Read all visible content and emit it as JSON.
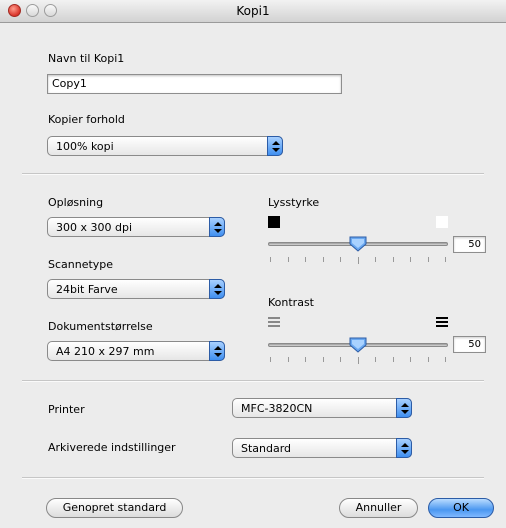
{
  "window": {
    "title": "Kopi1"
  },
  "name_section": {
    "label": "Navn til Kopi1",
    "value": "Copy1"
  },
  "ratio_section": {
    "label": "Kopier forhold",
    "selected": "100% kopi"
  },
  "resolution": {
    "label": "Opløsning",
    "selected": "300 x 300 dpi"
  },
  "scan_type": {
    "label": "Scannetype",
    "selected": "24bit Farve"
  },
  "doc_size": {
    "label": "Dokumentstørrelse",
    "selected": "A4 210 x 297 mm"
  },
  "brightness": {
    "label": "Lysstyrke",
    "value": "50",
    "level": 0.5
  },
  "contrast": {
    "label": "Kontrast",
    "value": "50",
    "level": 0.5
  },
  "printer": {
    "label": "Printer",
    "selected": "MFC-3820CN"
  },
  "archived": {
    "label": "Arkiverede indstillinger",
    "selected": "Standard"
  },
  "buttons": {
    "restore": "Genopret standard",
    "cancel": "Annuller",
    "ok": "OK"
  },
  "colors": {
    "accent": "#4b97f0",
    "window_bg": "#ececec"
  }
}
